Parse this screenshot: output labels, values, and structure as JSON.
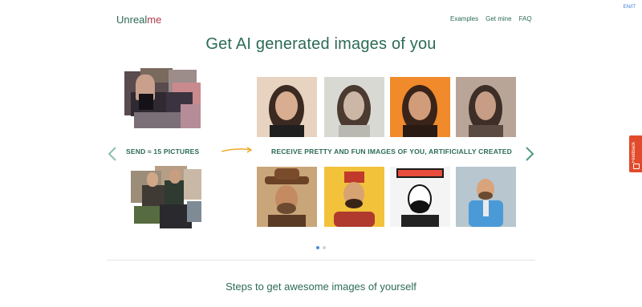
{
  "header": {
    "language_switch": "EN/IT",
    "brand_first": "Unreal",
    "brand_second": "me",
    "nav": [
      "Examples",
      "Get mine",
      "FAQ"
    ]
  },
  "hero": {
    "title": "Get AI generated images of you"
  },
  "carousel": {
    "send_label": "SEND ≈ 15 PICTURES",
    "receive_label": "RECEIVE PRETTY AND FUN IMAGES OF YOU, ARTIFICIALLY CREATED",
    "prev_icon": "chevron-left-icon",
    "next_icon": "chevron-right-icon",
    "page_count": 2,
    "active_page": 1
  },
  "steps": {
    "title": "Steps to get awesome images of yourself"
  },
  "feedback": {
    "label": "Feedback"
  },
  "colors": {
    "brand_green": "#2c6b55",
    "brand_red": "#b03a48",
    "arrow_orange": "#f0a92a",
    "feedback_red": "#e14b2b"
  }
}
